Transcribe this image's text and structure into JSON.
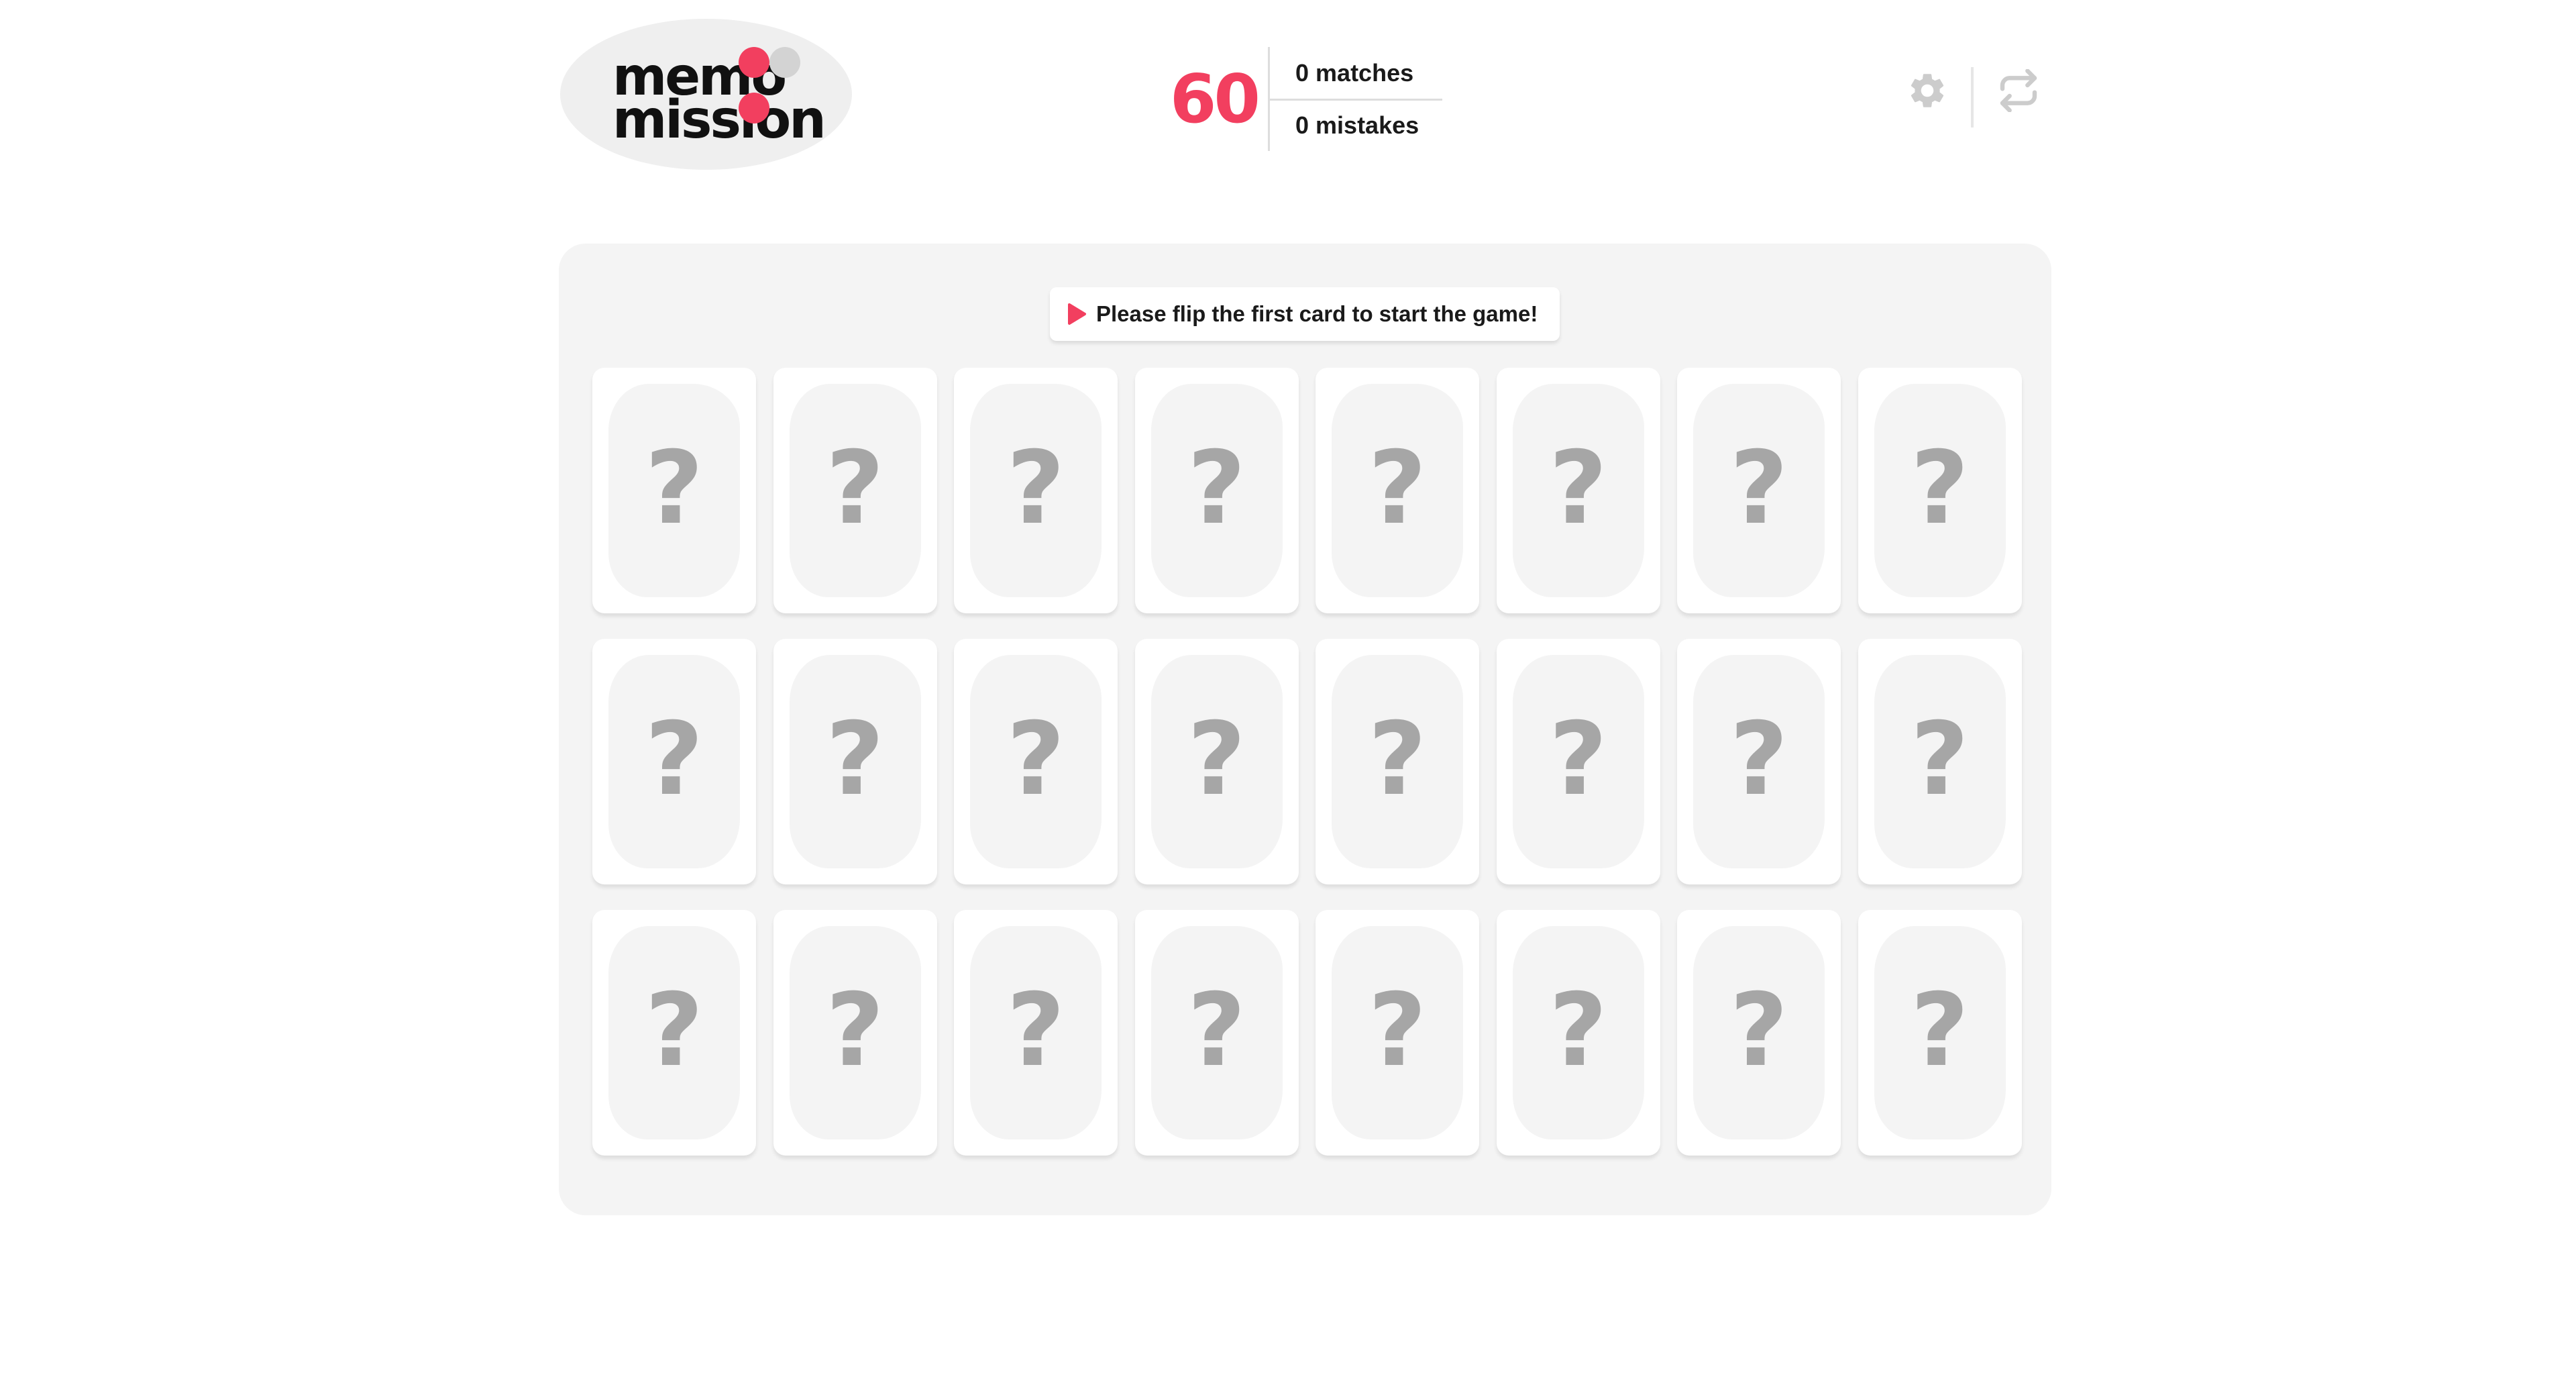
{
  "header": {
    "logo": {
      "line1": "memo",
      "line2": "mission"
    },
    "score": "60",
    "matches": {
      "count": "0",
      "label": "matches"
    },
    "mistakes": {
      "count": "0",
      "label": "mistakes"
    },
    "icons": {
      "settings": "gear-icon",
      "restart": "refresh-icon"
    }
  },
  "board": {
    "hint": "Please flip the first card to start the game!",
    "card_symbol": "?",
    "rows": 3,
    "columns": 8
  },
  "colors": {
    "accent": "#f23f5f",
    "logo_dot_gray": "#d3d3d3",
    "board_bg": "#f4f4f4",
    "card_face": "#ffffff",
    "card_mark": "#a6a6a6",
    "icon_gray": "#cccccc"
  }
}
